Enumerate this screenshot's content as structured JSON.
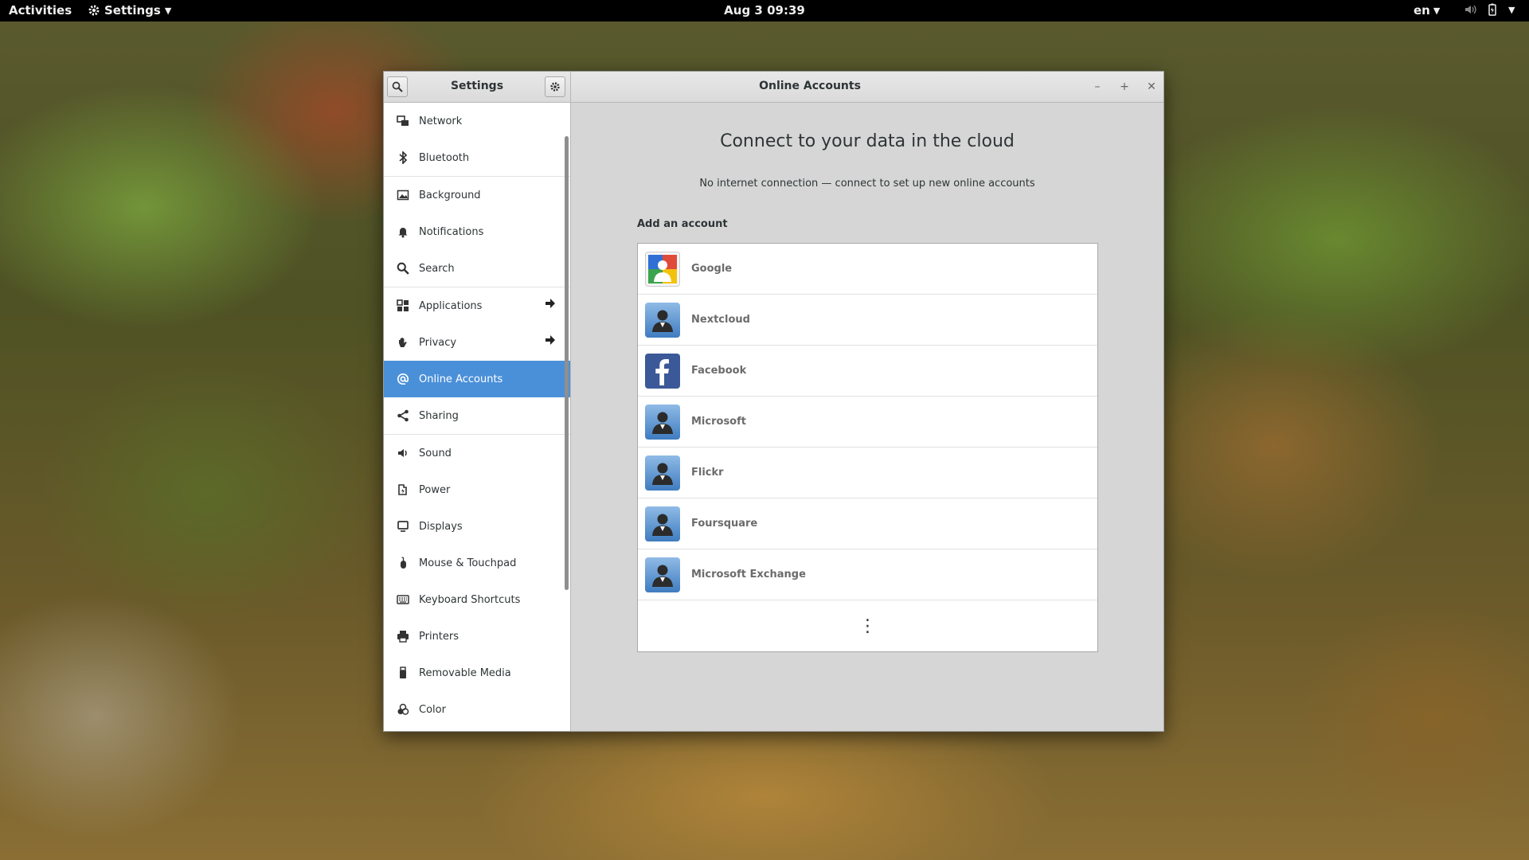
{
  "topbar": {
    "activities": "Activities",
    "app_menu": "Settings",
    "clock": "Aug 3  09:39",
    "language": "en"
  },
  "window": {
    "sidebar_title": "Settings",
    "panel_title": "Online Accounts"
  },
  "sidebar": {
    "items": [
      {
        "label": "Network",
        "icon": "network-icon"
      },
      {
        "label": "Bluetooth",
        "icon": "bluetooth-icon"
      },
      {
        "label": "Background",
        "icon": "background-icon"
      },
      {
        "label": "Notifications",
        "icon": "bell-icon"
      },
      {
        "label": "Search",
        "icon": "search-icon"
      },
      {
        "label": "Applications",
        "icon": "grid-icon"
      },
      {
        "label": "Privacy",
        "icon": "hand-icon"
      },
      {
        "label": "Online Accounts",
        "icon": "at-icon"
      },
      {
        "label": "Sharing",
        "icon": "share-icon"
      },
      {
        "label": "Sound",
        "icon": "speaker-icon"
      },
      {
        "label": "Power",
        "icon": "power-icon"
      },
      {
        "label": "Displays",
        "icon": "display-icon"
      },
      {
        "label": "Mouse & Touchpad",
        "icon": "mouse-icon"
      },
      {
        "label": "Keyboard Shortcuts",
        "icon": "keyboard-icon"
      },
      {
        "label": "Printers",
        "icon": "printer-icon"
      },
      {
        "label": "Removable Media",
        "icon": "usb-icon"
      },
      {
        "label": "Color",
        "icon": "color-icon"
      }
    ]
  },
  "content": {
    "title": "Connect to your data in the cloud",
    "subtitle": "No internet connection — connect to set up new online accounts",
    "add_heading": "Add an account",
    "accounts": [
      {
        "label": "Google"
      },
      {
        "label": "Nextcloud"
      },
      {
        "label": "Facebook"
      },
      {
        "label": "Microsoft"
      },
      {
        "label": "Flickr"
      },
      {
        "label": "Foursquare"
      },
      {
        "label": "Microsoft Exchange"
      }
    ]
  },
  "colors": {
    "accent": "#4a90d9",
    "facebook": "#3b5998"
  }
}
